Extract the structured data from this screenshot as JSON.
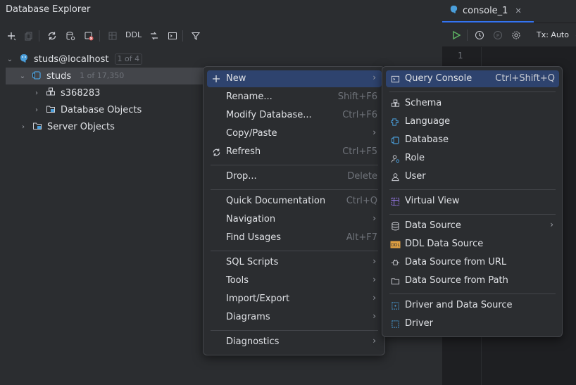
{
  "explorer": {
    "title": "Database Explorer",
    "toolbar": {
      "ddl_label": "DDL"
    },
    "tree": [
      {
        "label": "studs@localhost",
        "badge": "1 of 4"
      },
      {
        "label": "studs",
        "badge": "1 of 17,350"
      },
      {
        "label": "s368283"
      },
      {
        "label": "Database Objects"
      },
      {
        "label": "Server Objects"
      }
    ]
  },
  "editor": {
    "tab_label": "console_1",
    "close_glyph": "✕",
    "tx_label": "Tx: Auto",
    "line_number": "1"
  },
  "context_menu": {
    "items": [
      {
        "label": "New",
        "shortcut": ""
      },
      {
        "label": "Rename...",
        "shortcut": "Shift+F6"
      },
      {
        "label": "Modify Database...",
        "shortcut": "Ctrl+F6"
      },
      {
        "label": "Copy/Paste",
        "shortcut": ""
      },
      {
        "label": "Refresh",
        "shortcut": "Ctrl+F5"
      },
      {
        "label": "Drop...",
        "shortcut": "Delete"
      },
      {
        "label": "Quick Documentation",
        "shortcut": "Ctrl+Q"
      },
      {
        "label": "Navigation",
        "shortcut": ""
      },
      {
        "label": "Find Usages",
        "shortcut": "Alt+F7"
      },
      {
        "label": "SQL Scripts",
        "shortcut": ""
      },
      {
        "label": "Tools",
        "shortcut": ""
      },
      {
        "label": "Import/Export",
        "shortcut": ""
      },
      {
        "label": "Diagrams",
        "shortcut": ""
      },
      {
        "label": "Diagnostics",
        "shortcut": ""
      }
    ]
  },
  "submenu": {
    "items": [
      {
        "label": "Query Console",
        "shortcut": "Ctrl+Shift+Q"
      },
      {
        "label": "Schema"
      },
      {
        "label": "Language"
      },
      {
        "label": "Database"
      },
      {
        "label": "Role"
      },
      {
        "label": "User"
      },
      {
        "label": "Virtual View"
      },
      {
        "label": "Data Source"
      },
      {
        "label": "DDL Data Source"
      },
      {
        "label": "Data Source from URL"
      },
      {
        "label": "Data Source from Path"
      },
      {
        "label": "Driver and Data Source"
      },
      {
        "label": "Driver"
      }
    ]
  },
  "colors": {
    "accent": "#3574f0",
    "selection": "#2e436e",
    "postgres_blue": "#4a9eda",
    "run_green": "#5fb865",
    "purple": "#9d7cf0",
    "orange": "#e0a042"
  }
}
